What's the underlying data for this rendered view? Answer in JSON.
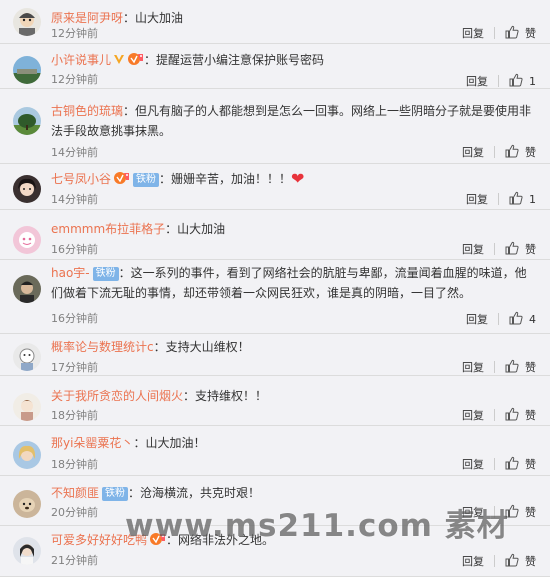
{
  "reply_label": "回复",
  "comments": [
    {
      "avatar": "avatar-kid",
      "user": "原来是阿尹呀",
      "prefix": "：",
      "text": "山大加油",
      "time": "12分钟前",
      "like": "赞",
      "badges": []
    },
    {
      "avatar": "avatar-sky",
      "user": "小许说事儿",
      "prefix": "：",
      "text": "提醒运营小编注意保护账号密码",
      "time": "12分钟前",
      "like": "1",
      "badges": [
        "verified-v-icon",
        "vip-badge-icon"
      ]
    },
    {
      "avatar": "avatar-tree",
      "user": "古铜色的琉璃",
      "prefix": "：",
      "text": "但凡有脑子的人都能想到是怎么一回事。网络上一些阴暗分子就是要使用非法手段故意挑事抹黑。",
      "time": "14分钟前",
      "like": "赞",
      "badges": []
    },
    {
      "avatar": "avatar-girl",
      "user": "七号凤小谷",
      "prefix": "：",
      "text": "姗姗辛苦，加油！！！",
      "time": "14分钟前",
      "like": "1",
      "badges": [
        "vip-badge-icon",
        "fan-badge"
      ],
      "heart": true
    },
    {
      "avatar": "avatar-pink",
      "user": "emmmm布拉菲格子",
      "prefix": "：",
      "text": "山大加油",
      "time": "16分钟前",
      "like": "赞",
      "badges": []
    },
    {
      "avatar": "avatar-boy",
      "user": "hao宇-",
      "prefix": "：",
      "text": "这一系列的事件，看到了网络社会的肮脏与卑鄙，流量闻着血腥的味道，他们做着下流无耻的事情，却还带领着一众网民狂欢，谁是真的阴暗，一目了然。",
      "time": "16分钟前",
      "like": "4",
      "badges": [
        "fan-badge"
      ]
    },
    {
      "avatar": "avatar-cartoon",
      "user": "概率论与数理统计c",
      "prefix": "：",
      "text": "支持大山维权！",
      "time": "17分钟前",
      "like": "赞",
      "badges": []
    },
    {
      "avatar": "avatar-anime",
      "user": "关于我所贪恋的人间烟火",
      "prefix": "：",
      "text": "支持维权！！",
      "time": "18分钟前",
      "like": "赞",
      "badges": []
    },
    {
      "avatar": "avatar-blonde",
      "user": "那yi朵罂粟花丶",
      "prefix": "：",
      "text": "山大加油！",
      "time": "18分钟前",
      "like": "赞",
      "badges": []
    },
    {
      "avatar": "avatar-dog",
      "user": "不知颜匪",
      "prefix": "：",
      "text": "沧海横流，共克时艰！",
      "time": "20分钟前",
      "like": "赞",
      "badges": [
        "fan-badge"
      ]
    },
    {
      "avatar": "avatar-portrait",
      "user": "可爱多好好好吃鸭",
      "prefix": "：",
      "text": "网络非法外之地。",
      "time": "21分钟前",
      "like": "赞",
      "badges": [
        "vip-badge-icon"
      ]
    }
  ],
  "fan_label": "铁粉",
  "watermark": "www.ms211.com 素材"
}
